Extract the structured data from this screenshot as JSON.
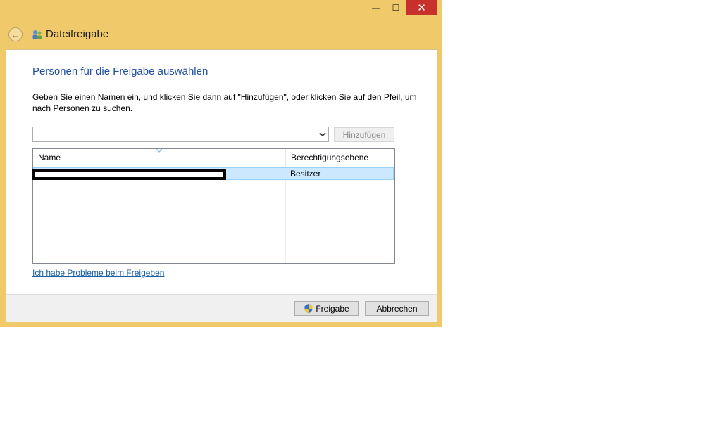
{
  "window": {
    "title": "Dateifreigabe",
    "caption": {
      "minimize": "—",
      "maximize": "☐",
      "close": "✕"
    },
    "colors": {
      "frame": "#f0c96a",
      "close": "#c7302b",
      "heading": "#1e4fa1",
      "link": "#1c5fa8",
      "selection": "#cce8ff"
    }
  },
  "dialog": {
    "heading": "Personen für die Freigabe auswählen",
    "instruction": "Geben Sie einen Namen ein, und klicken Sie dann auf \"Hinzufügen\", oder klicken Sie auf den Pfeil, um nach Personen zu suchen.",
    "combo": {
      "value": ""
    },
    "add_button": "Hinzufügen",
    "list": {
      "columns": [
        "Name",
        "Berechtigungsebene"
      ],
      "rows": [
        {
          "name": "",
          "permission": "Besitzer",
          "selected": true
        }
      ]
    },
    "help_link": "Ich habe Probleme beim Freigeben"
  },
  "footer": {
    "share_button": "Freigabe",
    "cancel_button": "Abbrechen"
  }
}
